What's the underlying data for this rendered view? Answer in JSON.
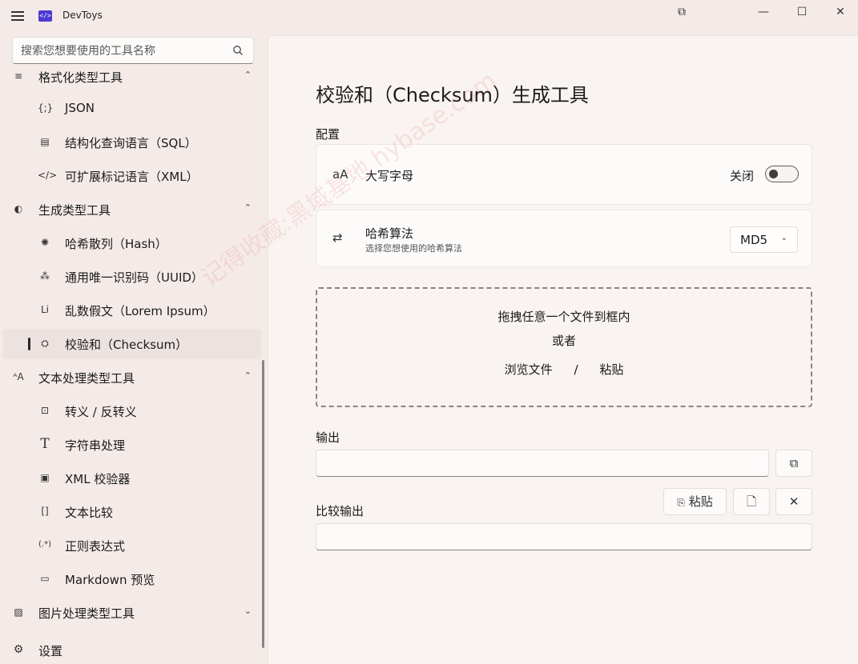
{
  "titlebar": {
    "app_title": "DevToys",
    "logo_glyph": "</>",
    "compact_glyph": "⧉",
    "minimize_glyph": "—",
    "maximize_glyph": "☐",
    "close_glyph": "✕"
  },
  "search": {
    "placeholder": "搜索您想要使用的工具名称"
  },
  "sidebar": {
    "items": [
      {
        "label": "格式化类型工具",
        "icon": "format-icon",
        "glyph": "≡",
        "chevron": "⌃",
        "kind": "group"
      },
      {
        "label": "JSON",
        "icon": "json-icon",
        "glyph": "{;}",
        "kind": "sub"
      },
      {
        "label": "结构化查询语言（SQL）",
        "icon": "sql-icon",
        "glyph": "▤",
        "kind": "sub"
      },
      {
        "label": "可扩展标记语言（XML）",
        "icon": "xml-icon",
        "glyph": "</>",
        "kind": "sub"
      },
      {
        "label": "生成类型工具",
        "icon": "generator-icon",
        "glyph": "◐",
        "chevron": "⌃",
        "kind": "group"
      },
      {
        "label": "哈希散列（Hash）",
        "icon": "hash-icon",
        "glyph": "✺",
        "kind": "sub"
      },
      {
        "label": "通用唯一识别码（UUID）",
        "icon": "uuid-icon",
        "glyph": "⁂",
        "kind": "sub"
      },
      {
        "label": "乱数假文（Lorem Ipsum）",
        "icon": "lorem-icon",
        "glyph": "Li",
        "kind": "sub"
      },
      {
        "label": "校验和（Checksum）",
        "icon": "checksum-icon",
        "glyph": "⛭",
        "kind": "sub",
        "selected": true
      },
      {
        "label": "文本处理类型工具",
        "icon": "text-icon",
        "glyph": "ᴬA",
        "chevron": "⌃",
        "kind": "group"
      },
      {
        "label": "转义 / 反转义",
        "icon": "escape-icon",
        "glyph": "⊡",
        "kind": "sub"
      },
      {
        "label": "字符串处理",
        "icon": "string-icon",
        "glyph": "T",
        "kind": "sub"
      },
      {
        "label": "XML 校验器",
        "icon": "xml-validator-icon",
        "glyph": "▣",
        "kind": "sub"
      },
      {
        "label": "文本比较",
        "icon": "diff-icon",
        "glyph": "[]",
        "kind": "sub"
      },
      {
        "label": "正则表达式",
        "icon": "regex-icon",
        "glyph": "(.*)",
        "kind": "sub"
      },
      {
        "label": "Markdown 预览",
        "icon": "markdown-icon",
        "glyph": "▭",
        "kind": "sub"
      },
      {
        "label": "图片处理类型工具",
        "icon": "image-icon",
        "glyph": "▨",
        "chevron": "⌄",
        "kind": "group"
      }
    ],
    "settings_label": "设置",
    "settings_glyph": "⚙"
  },
  "main": {
    "title": "校验和（Checksum）生成工具",
    "config_label": "配置",
    "uppercase": {
      "icon_glyph": "aA",
      "title": "大写字母",
      "state_text": "关闭"
    },
    "hash_algo": {
      "icon_glyph": "⇄",
      "title": "哈希算法",
      "description": "选择您想使用的哈希算法",
      "value": "MD5",
      "arrow": "⌄"
    },
    "dropzone": {
      "line1": "拖拽任意一个文件到框内",
      "line2": "或者",
      "browse": "浏览文件",
      "separator": "/",
      "paste": "粘贴"
    },
    "output_label": "输出",
    "compare_label": "比较输出",
    "paste_button": "粘贴",
    "copy_glyph": "⧉",
    "paste_glyph": "📋",
    "open_glyph": "🗋",
    "clear_glyph": "✕"
  },
  "watermark": "记得收藏:黑域基地 hybase.com"
}
